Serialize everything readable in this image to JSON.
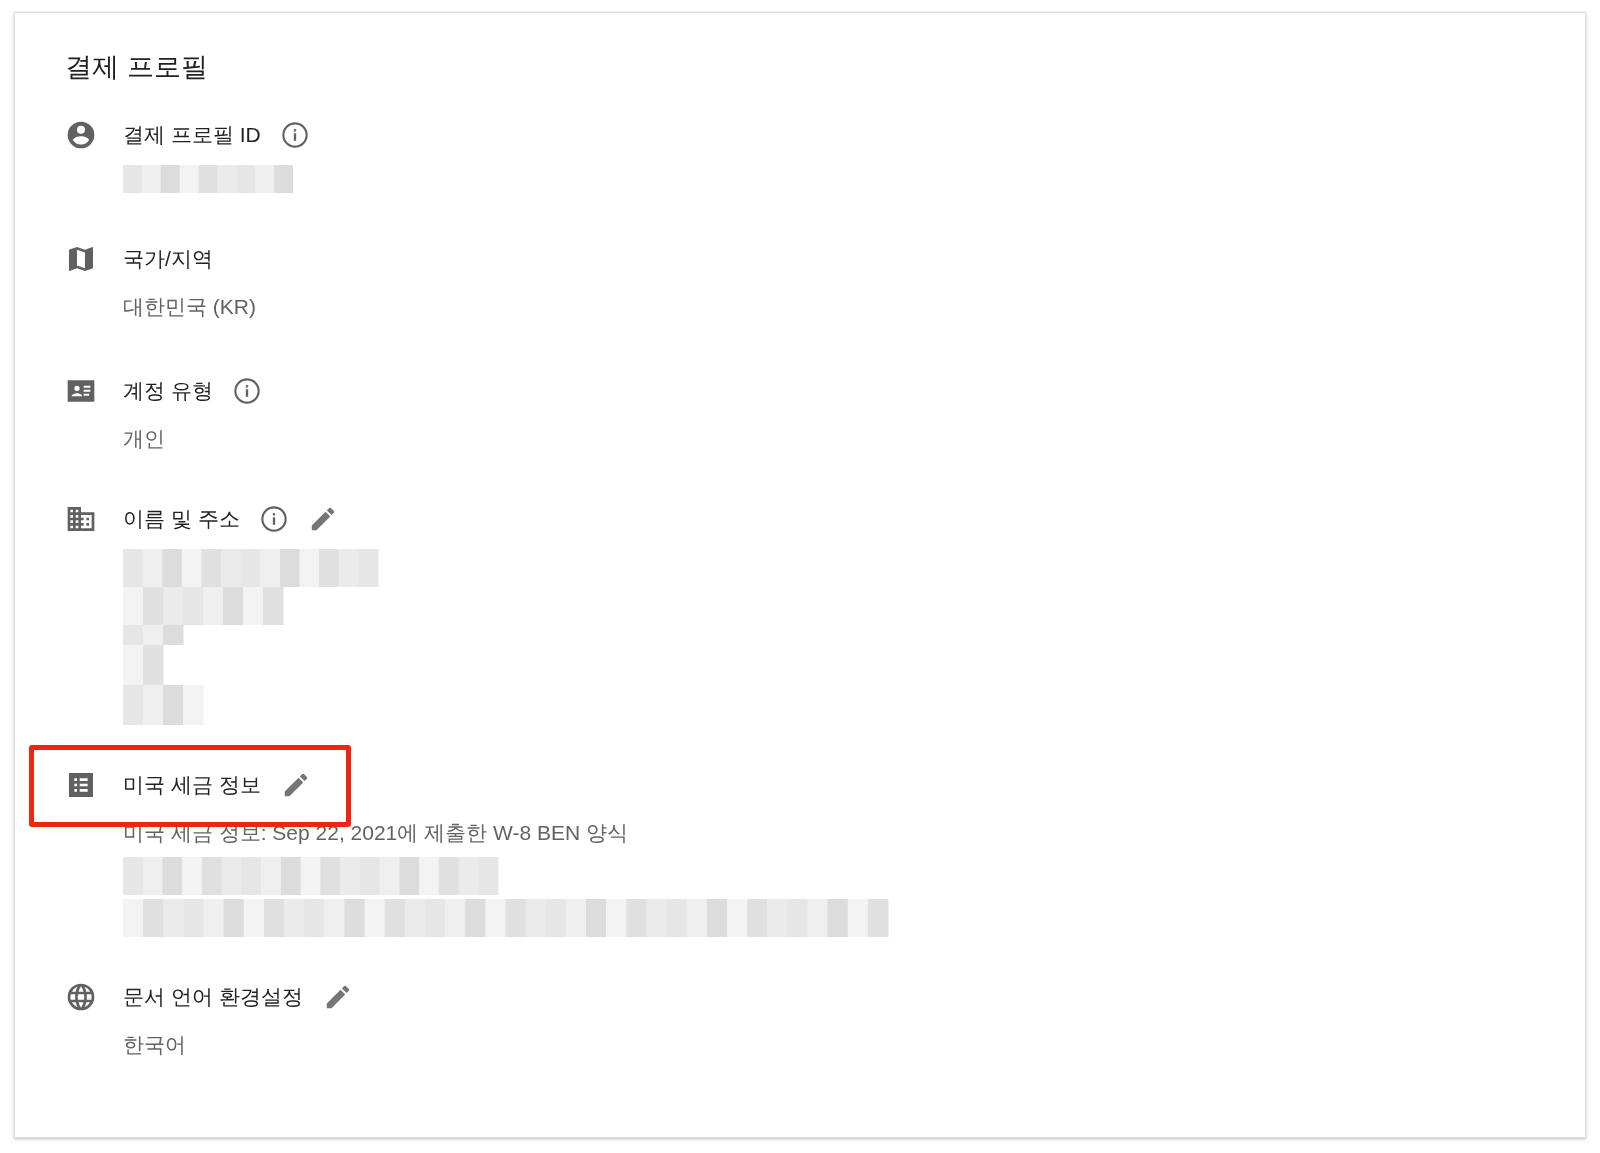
{
  "title": "결제 프로필",
  "sections": [
    {
      "label": "결제 프로필 ID",
      "info": true,
      "editable": false,
      "highlighted": false
    },
    {
      "label": "국가/지역",
      "info": false,
      "editable": false,
      "highlighted": false,
      "value": "대한민국 (KR)"
    },
    {
      "label": "계정 유형",
      "info": true,
      "editable": false,
      "highlighted": false,
      "value": "개인"
    },
    {
      "label": "이름 및 주소",
      "info": true,
      "editable": true,
      "highlighted": false
    },
    {
      "label": "미국 세금 정보",
      "info": false,
      "editable": true,
      "highlighted": true,
      "value": "미국 세금 정보: Sep 22, 2021에 제출한 W-8 BEN 양식"
    },
    {
      "label": "문서 언어 환경설정",
      "info": false,
      "editable": true,
      "highlighted": false,
      "value": "한국어"
    }
  ]
}
